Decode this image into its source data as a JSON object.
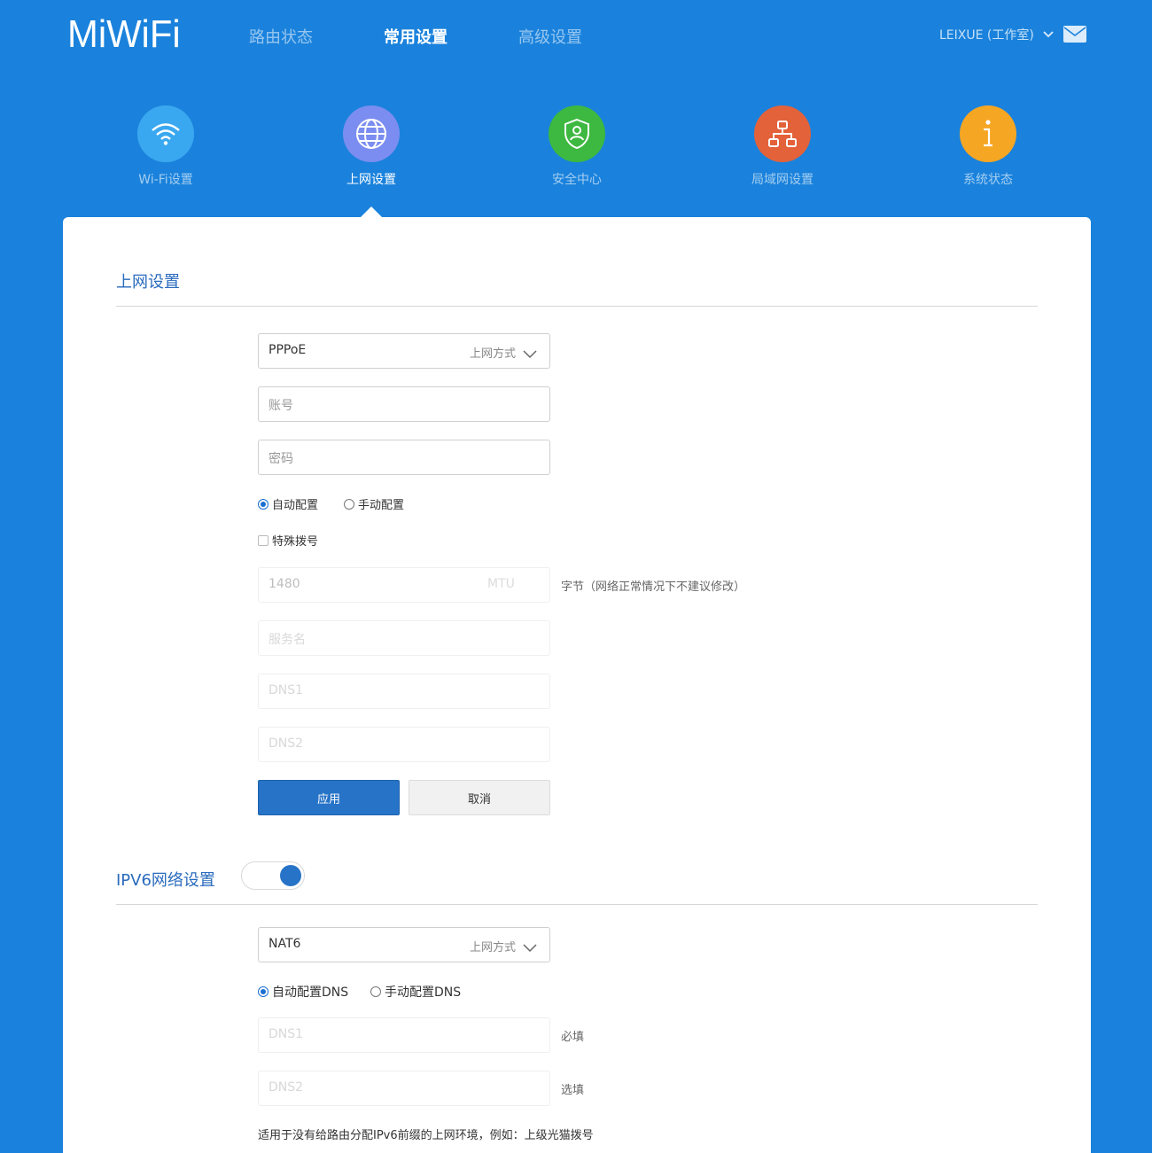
{
  "header": {
    "logo": "MiWiFi",
    "nav": [
      {
        "label": "路由状态",
        "active": false
      },
      {
        "label": "常用设置",
        "active": true
      },
      {
        "label": "高级设置",
        "active": false
      }
    ],
    "account": "LEIXUE (工作室)",
    "mail_icon": "mail-icon"
  },
  "categories": [
    {
      "label": "Wi-Fi设置",
      "icon": "wifi-icon",
      "color": "#3aa8f0",
      "active": false
    },
    {
      "label": "上网设置",
      "icon": "globe-icon",
      "color": "#7b8df0",
      "active": true
    },
    {
      "label": "安全中心",
      "icon": "shield-icon",
      "color": "#3db840",
      "active": false
    },
    {
      "label": "局域网设置",
      "icon": "network-icon",
      "color": "#e3623a",
      "active": false
    },
    {
      "label": "系统状态",
      "icon": "info-icon",
      "color": "#f5a623",
      "active": false
    }
  ],
  "internet": {
    "title": "上网设置",
    "mode_value": "PPPoE",
    "mode_label": "上网方式",
    "account_placeholder": "账号",
    "password_placeholder": "密码",
    "radio_auto": "自动配置",
    "radio_manual": "手动配置",
    "special_dial": "特殊拨号",
    "mtu_value": "1480",
    "mtu_unit": "MTU",
    "mtu_hint": "字节（网络正常情况下不建议修改）",
    "service_placeholder": "服务名",
    "dns1_placeholder": "DNS1",
    "dns2_placeholder": "DNS2",
    "apply": "应用",
    "cancel": "取消"
  },
  "ipv6": {
    "title": "IPV6网络设置",
    "enabled": true,
    "mode_value": "NAT6",
    "mode_label": "上网方式",
    "radio_auto": "自动配置DNS",
    "radio_manual": "手动配置DNS",
    "dns1_placeholder": "DNS1",
    "dns1_hint": "必填",
    "dns2_placeholder": "DNS2",
    "dns2_hint": "选填",
    "note": "适用于没有给路由分配IPv6前缀的上网环境，例如：上级光猫拨号"
  }
}
